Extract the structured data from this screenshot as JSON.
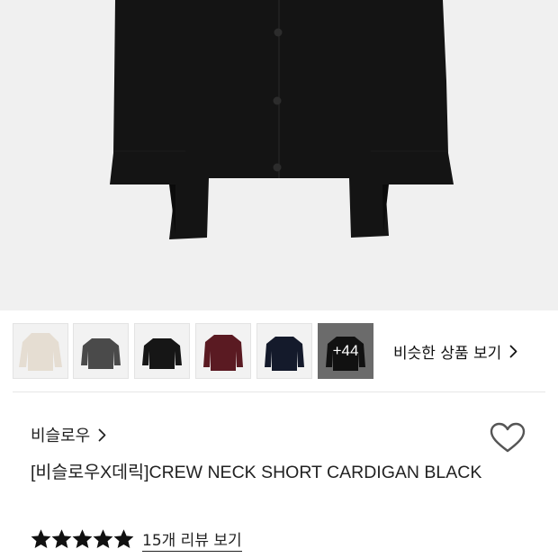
{
  "hero": {
    "image_alt": "black crew neck short cardigan",
    "background_color": "#f0f0f0",
    "garment_color": "#141414"
  },
  "thumbnails": {
    "items": [
      {
        "color_name": "beige",
        "color": "#e5ddd2"
      },
      {
        "color_name": "charcoal",
        "color": "#4a4a4a"
      },
      {
        "color_name": "black",
        "color": "#161616"
      },
      {
        "color_name": "burgundy",
        "color": "#5a1a22"
      },
      {
        "color_name": "navy",
        "color": "#141a2b"
      }
    ],
    "more_label": "+44"
  },
  "similar": {
    "label": "비슷한 상품 보기",
    "icon": "chevron-right-icon"
  },
  "product": {
    "brand": "비슬로우",
    "brand_icon": "chevron-right-icon",
    "title": "[비슬로우X데릭]CREW NECK SHORT CARDIGAN BLACK",
    "wishlist_icon": "heart-outline-icon"
  },
  "rating": {
    "stars": 5,
    "max_stars": 5,
    "review_label": "15개 리뷰 보기",
    "star_color": "#111111"
  }
}
